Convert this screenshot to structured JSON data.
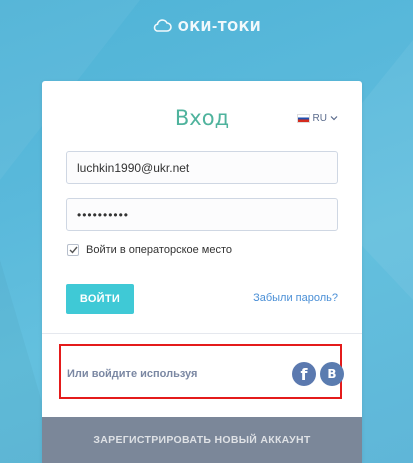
{
  "brand": {
    "name": "ОКИ-ТОКИ",
    "icon": "cloud-icon"
  },
  "login": {
    "title": "Вход",
    "language": {
      "code": "RU",
      "flag_icon": "russia-flag-icon"
    },
    "email_value": "luchkin1990@ukr.net",
    "password_masked": "••••••••••",
    "operator_checkbox": {
      "label": "Войти в операторское место",
      "checked": true
    },
    "submit_label": "ВОЙТИ",
    "forgot_label": "Забыли пароль?"
  },
  "social": {
    "prompt": "Или войдите используя",
    "providers": [
      {
        "name": "facebook",
        "glyph": "f",
        "icon": "facebook-icon"
      },
      {
        "name": "vkontakte",
        "glyph": "B",
        "icon": "vk-icon"
      }
    ]
  },
  "register_label": "ЗАРЕГИСТРИРОВАТЬ НОВЫЙ АККАУНТ",
  "colors": {
    "accent_teal": "#4fb39d",
    "button_cyan": "#3fc9d6",
    "link_blue": "#4a8fd6",
    "highlight_red": "#e41b1b",
    "register_gray": "#7b8799"
  }
}
